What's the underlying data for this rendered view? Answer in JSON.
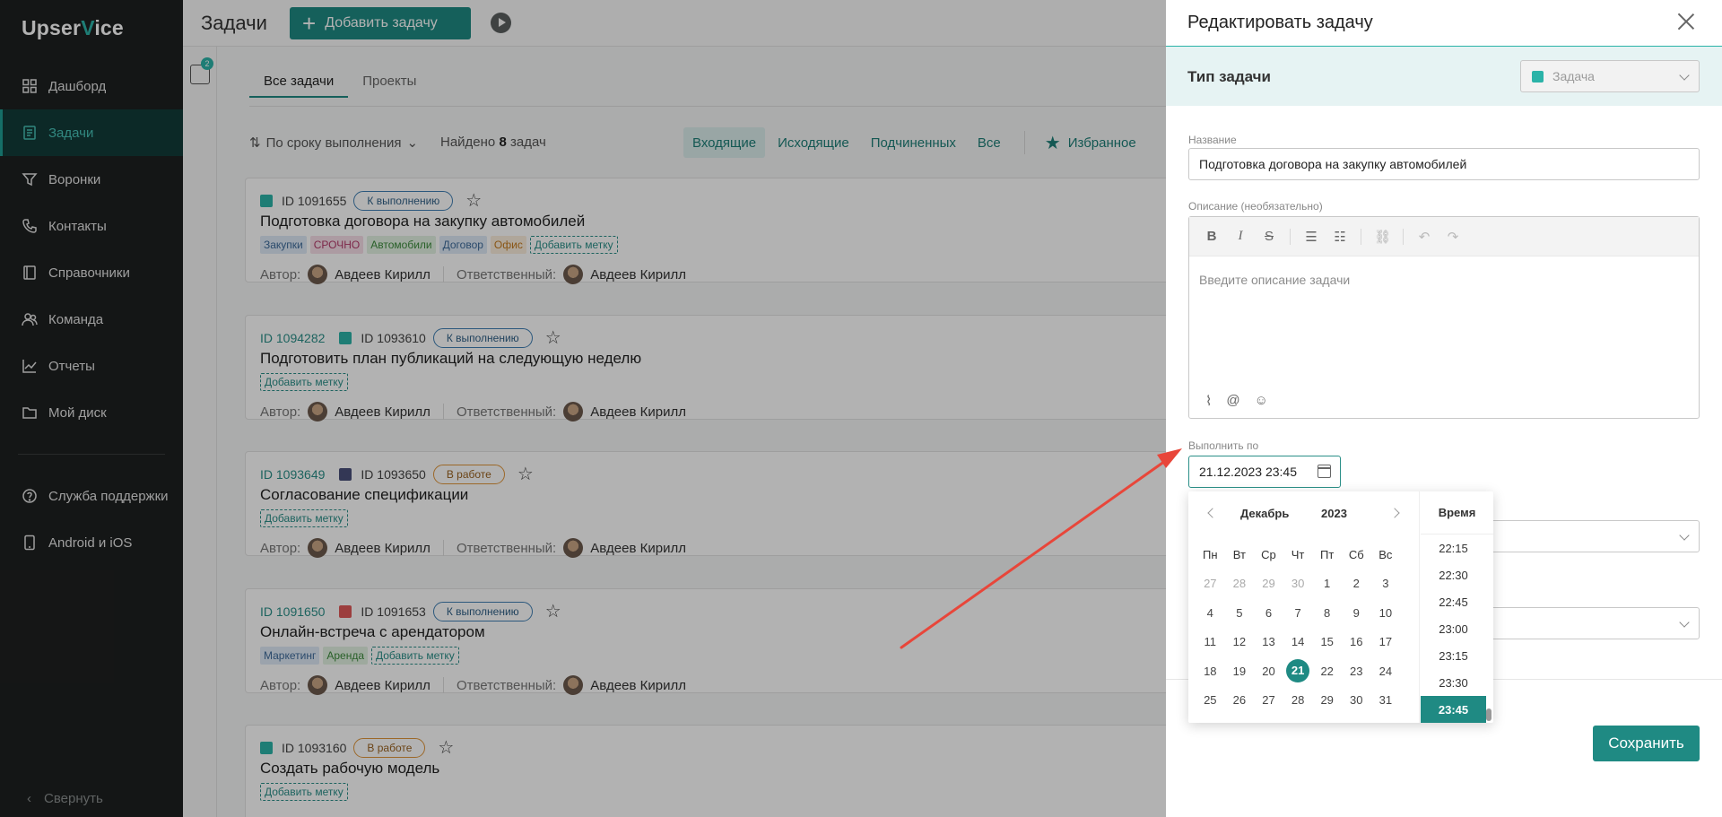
{
  "sidebar": {
    "logo_prefix": "Upser",
    "logo_v": "V",
    "logo_suffix": "ice",
    "items": [
      {
        "label": "Дашборд",
        "icon": "dashboard-icon",
        "active": false
      },
      {
        "label": "Задачи",
        "icon": "tasks-icon",
        "active": true
      },
      {
        "label": "Воронки",
        "icon": "funnel-icon",
        "active": false
      },
      {
        "label": "Контакты",
        "icon": "phone-icon",
        "active": false
      },
      {
        "label": "Справочники",
        "icon": "book-icon",
        "active": false
      },
      {
        "label": "Команда",
        "icon": "team-icon",
        "active": false
      },
      {
        "label": "Отчеты",
        "icon": "chart-icon",
        "active": false
      },
      {
        "label": "Мой диск",
        "icon": "folder-icon",
        "active": false
      }
    ],
    "support": "Служба поддержки",
    "mobile": "Android и iOS",
    "collapse": "Свернуть"
  },
  "header": {
    "title": "Задачи",
    "add_task": "Добавить задачу"
  },
  "filter_badge": "2",
  "tabs": [
    "Все задачи",
    "Проекты"
  ],
  "toolbar": {
    "sort": "По сроку выполнения",
    "found_prefix": "Найдено",
    "found_count": "8",
    "found_suffix": "задач",
    "filters": [
      "Входящие",
      "Исходящие",
      "Подчиненных",
      "Все"
    ],
    "favorite": "Избранное"
  },
  "labels": {
    "author": "Автор:",
    "responsible": "Ответственный:",
    "person": "Авдеев Кирилл",
    "add_tag": "Добавить метку"
  },
  "tasks": [
    {
      "parent_id": "",
      "id": "ID 1091655",
      "status": "К выполнению",
      "title": "Подготовка договора на закупку автомобилей",
      "tags": [
        "Закупки",
        "СРОЧНО",
        "Автомобили",
        "Договор",
        "Офис"
      ]
    },
    {
      "parent_id": "ID 1094282",
      "id": "ID 1093610",
      "status": "К выполнению",
      "title": "Подготовить план публикаций на следующую неделю",
      "tags": []
    },
    {
      "parent_id": "ID 1093649",
      "id": "ID 1093650",
      "status": "В работе",
      "title": "Согласование спецификации",
      "tags": []
    },
    {
      "parent_id": "ID 1091650",
      "id": "ID 1091653",
      "status": "К выполнению",
      "title": "Онлайн-встреча с арендатором",
      "tags": [
        "Маркетинг",
        "Аренда"
      ]
    },
    {
      "parent_id": "",
      "id": "ID 1093160",
      "status": "В работе",
      "title": "Создать рабочую модель",
      "tags": []
    }
  ],
  "drawer": {
    "title": "Редактировать задачу",
    "type_label": "Тип задачи",
    "type_value": "Задача",
    "name_label": "Название",
    "name_value": "Подготовка договора на закупку автомобилей",
    "desc_label": "Описание (необязательно)",
    "desc_placeholder": "Введите описание задачи",
    "due_label": "Выполнить по",
    "due_value": "21.12.2023 23:45",
    "save": "Сохранить"
  },
  "datepicker": {
    "month": "Декабрь",
    "year": "2023",
    "weekdays": [
      "Пн",
      "Вт",
      "Ср",
      "Чт",
      "Пт",
      "Сб",
      "Вс"
    ],
    "weeks": [
      [
        "27",
        "28",
        "29",
        "30",
        "1",
        "2",
        "3"
      ],
      [
        "4",
        "5",
        "6",
        "7",
        "8",
        "9",
        "10"
      ],
      [
        "11",
        "12",
        "13",
        "14",
        "15",
        "16",
        "17"
      ],
      [
        "18",
        "19",
        "20",
        "21",
        "22",
        "23",
        "24"
      ],
      [
        "25",
        "26",
        "27",
        "28",
        "29",
        "30",
        "31"
      ]
    ],
    "selected_day": "21",
    "time_label": "Время",
    "times": [
      "22:15",
      "22:30",
      "22:45",
      "23:00",
      "23:15",
      "23:30",
      "23:45"
    ],
    "selected_time": "23:45"
  },
  "colors": {
    "accent": "#1f8a83",
    "sidebar_bg": "#1e2020",
    "arrow": "#e8463a"
  }
}
